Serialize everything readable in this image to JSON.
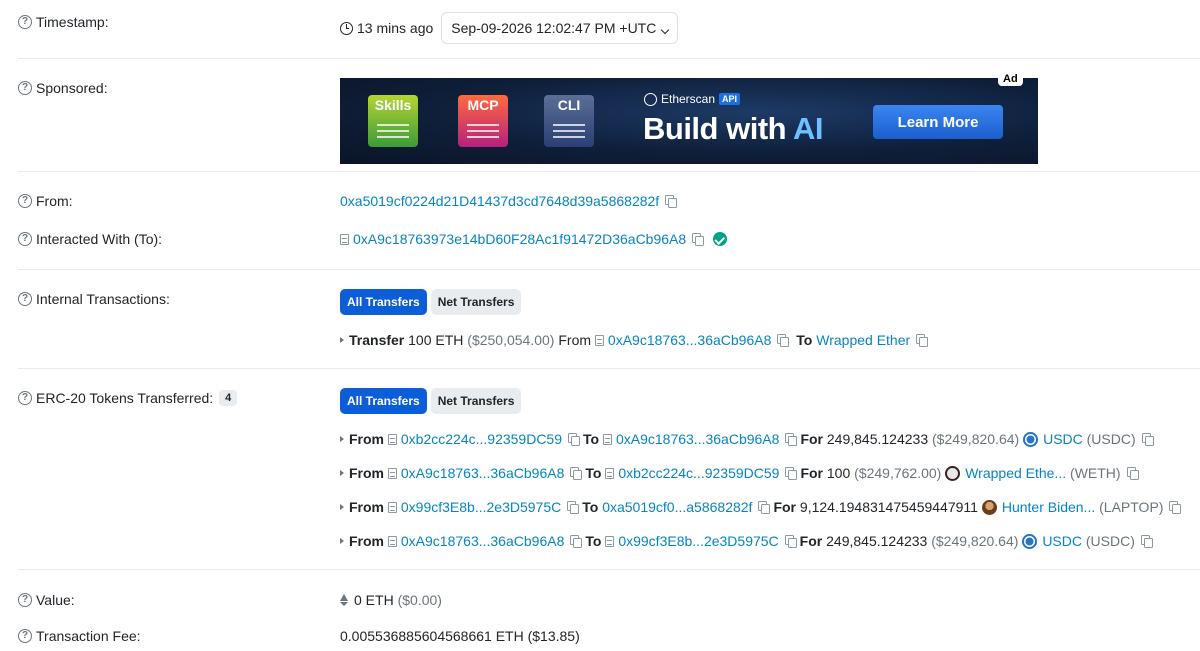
{
  "labels": {
    "timestamp": "Timestamp:",
    "sponsored": "Sponsored:",
    "from": "From:",
    "interacted": "Interacted With (To):",
    "internal": "Internal Transactions:",
    "erc20": "ERC-20 Tokens Transferred:",
    "erc20_count": "4",
    "value": "Value:",
    "fee": "Transaction Fee:"
  },
  "timestamp": {
    "ago": "13 mins ago",
    "datetime": "Sep-09-2026 12:02:47 PM +UTC"
  },
  "ad": {
    "tag": "Ad",
    "cards": [
      "Skills",
      "MCP",
      "CLI"
    ],
    "brand": "Etherscan",
    "api": "API",
    "headline_prefix": "Build with ",
    "headline_ai": "AI",
    "cta": "Learn More"
  },
  "from_address": "0xa5019cf0224d21D41437d3cd7648d39a5868282f",
  "to_address": "0xA9c18763973e14bD60F28Ac1f91472D36aCb96A8",
  "tabs": {
    "all": "All Transfers",
    "net": "Net Transfers"
  },
  "words": {
    "transfer": "Transfer",
    "from": "From",
    "to": "To",
    "for": "For"
  },
  "internal_tx": {
    "amount": "100 ETH",
    "usd": "($250,054.00)",
    "from": "0xA9c18763...36aCb96A8",
    "to": "Wrapped Ether"
  },
  "erc20_rows": [
    {
      "from": "0xb2cc224c...92359DC59",
      "to": "0xA9c18763...36aCb96A8",
      "amount": "249,845.124233",
      "usd": "($249,820.64)",
      "token": "USDC",
      "symbol": "(USDC)",
      "icon": "usdc-icon"
    },
    {
      "from": "0xA9c18763...36aCb96A8",
      "to": "0xb2cc224c...92359DC59",
      "amount": "100",
      "usd": "($249,762.00)",
      "token": "Wrapped Ethe...",
      "symbol": "(WETH)",
      "icon": "weth-icon"
    },
    {
      "from": "0x99cf3E8b...2e3D5975C",
      "to": "0xa5019cf0...a5868282f",
      "amount": "9,124.194831475459447911",
      "usd": "",
      "token": "Hunter Biden...",
      "symbol": "(LAPTOP)",
      "icon": "laptop-token-icon"
    },
    {
      "from": "0xA9c18763...36aCb96A8",
      "to": "0x99cf3E8b...2e3D5975C",
      "amount": "249,845.124233",
      "usd": "($249,820.64)",
      "token": "USDC",
      "symbol": "(USDC)",
      "icon": "usdc-icon"
    }
  ],
  "value": {
    "eth": "0 ETH",
    "usd": "($0.00)"
  },
  "fee": "0.005536885604568661 ETH ($13.85)",
  "colors": {
    "link": "#0784c3",
    "primary_button": "#0b5ed7",
    "verified": "#00a186"
  }
}
